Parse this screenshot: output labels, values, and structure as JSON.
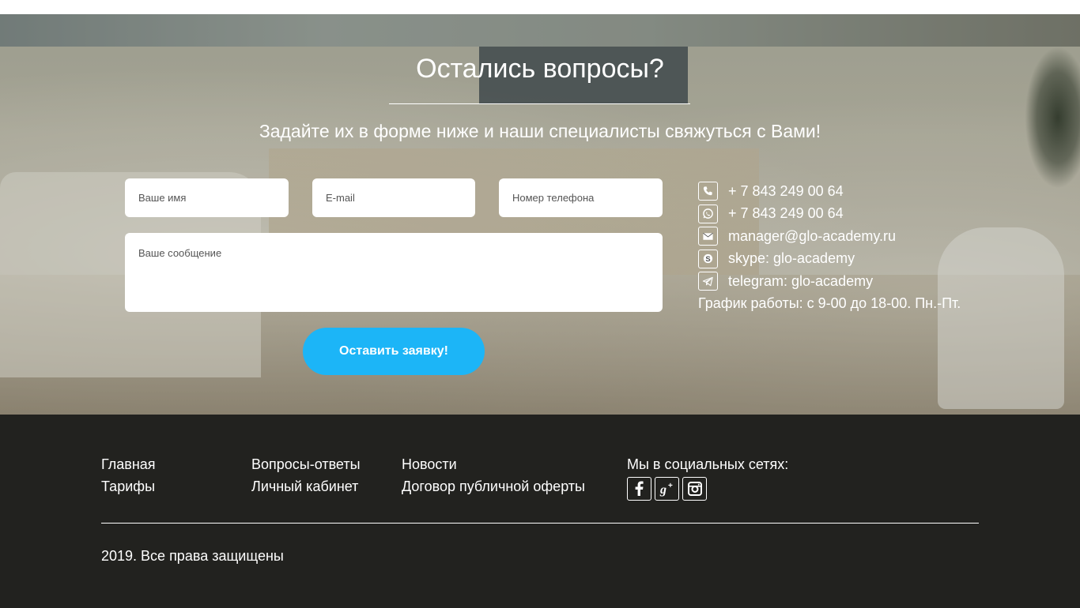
{
  "section": {
    "title": "Остались вопросы?",
    "subtitle": "Задайте их в форме ниже и наши специалисты свяжуться с Вами!"
  },
  "form": {
    "name_placeholder": "Ваше имя",
    "email_placeholder": "E-mail",
    "phone_placeholder": "Номер телефона",
    "message_placeholder": "Ваше сообщение",
    "submit_label": "Оставить заявку!",
    "submit_color": "#1cb5f7"
  },
  "contacts": {
    "items": [
      {
        "icon": "phone-icon",
        "text": "+ 7 843 249 00 64"
      },
      {
        "icon": "whatsapp-icon",
        "text": "+ 7 843 249 00 64"
      },
      {
        "icon": "envelope-icon",
        "text": "manager@glo-academy.ru"
      },
      {
        "icon": "skype-icon",
        "text": "skype: glo-academy"
      },
      {
        "icon": "telegram-icon",
        "text": "telegram: glo-academy"
      }
    ],
    "schedule": "График работы: с 9-00 до 18-00. Пн.-Пт."
  },
  "footer": {
    "nav": [
      [
        "Главная",
        "Тарифы"
      ],
      [
        "Вопросы-ответы",
        "Личный кабинет"
      ],
      [
        "Новости",
        "Договор публичной оферты"
      ]
    ],
    "social_label": "Мы в социальных сетях:",
    "social": [
      "facebook-icon",
      "google-plus-icon",
      "instagram-icon"
    ],
    "copyright": "2019. Все права защищены",
    "background": "#22221f"
  }
}
